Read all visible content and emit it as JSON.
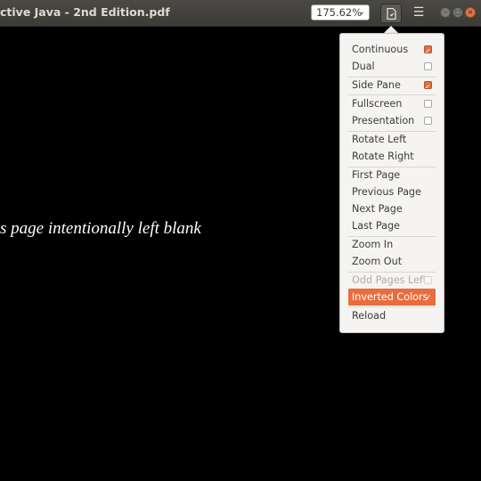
{
  "window": {
    "title": "ctive Java - 2nd Edition.pdf",
    "zoom_value": "175.62%"
  },
  "document": {
    "text": "s page intentionally left blank"
  },
  "menu": {
    "items": [
      {
        "label": "Continuous",
        "checked": true
      },
      {
        "label": "Dual",
        "checked": false
      },
      {
        "label": "Side Pane",
        "checked": true
      },
      {
        "label": "Fullscreen",
        "checked": false
      },
      {
        "label": "Presentation",
        "checked": false
      },
      {
        "label": "Rotate Left"
      },
      {
        "label": "Rotate Right"
      },
      {
        "label": "First Page"
      },
      {
        "label": "Previous Page"
      },
      {
        "label": "Next Page"
      },
      {
        "label": "Last Page"
      },
      {
        "label": "Zoom In"
      },
      {
        "label": "Zoom Out"
      },
      {
        "label": "Odd Pages Left",
        "checked": false,
        "disabled": true
      },
      {
        "label": "Inverted Colors",
        "checked": true,
        "highlighted": true
      },
      {
        "label": "Reload"
      }
    ]
  },
  "colors": {
    "accent": "#e96d3d",
    "headerbar": "#3c3b37"
  }
}
